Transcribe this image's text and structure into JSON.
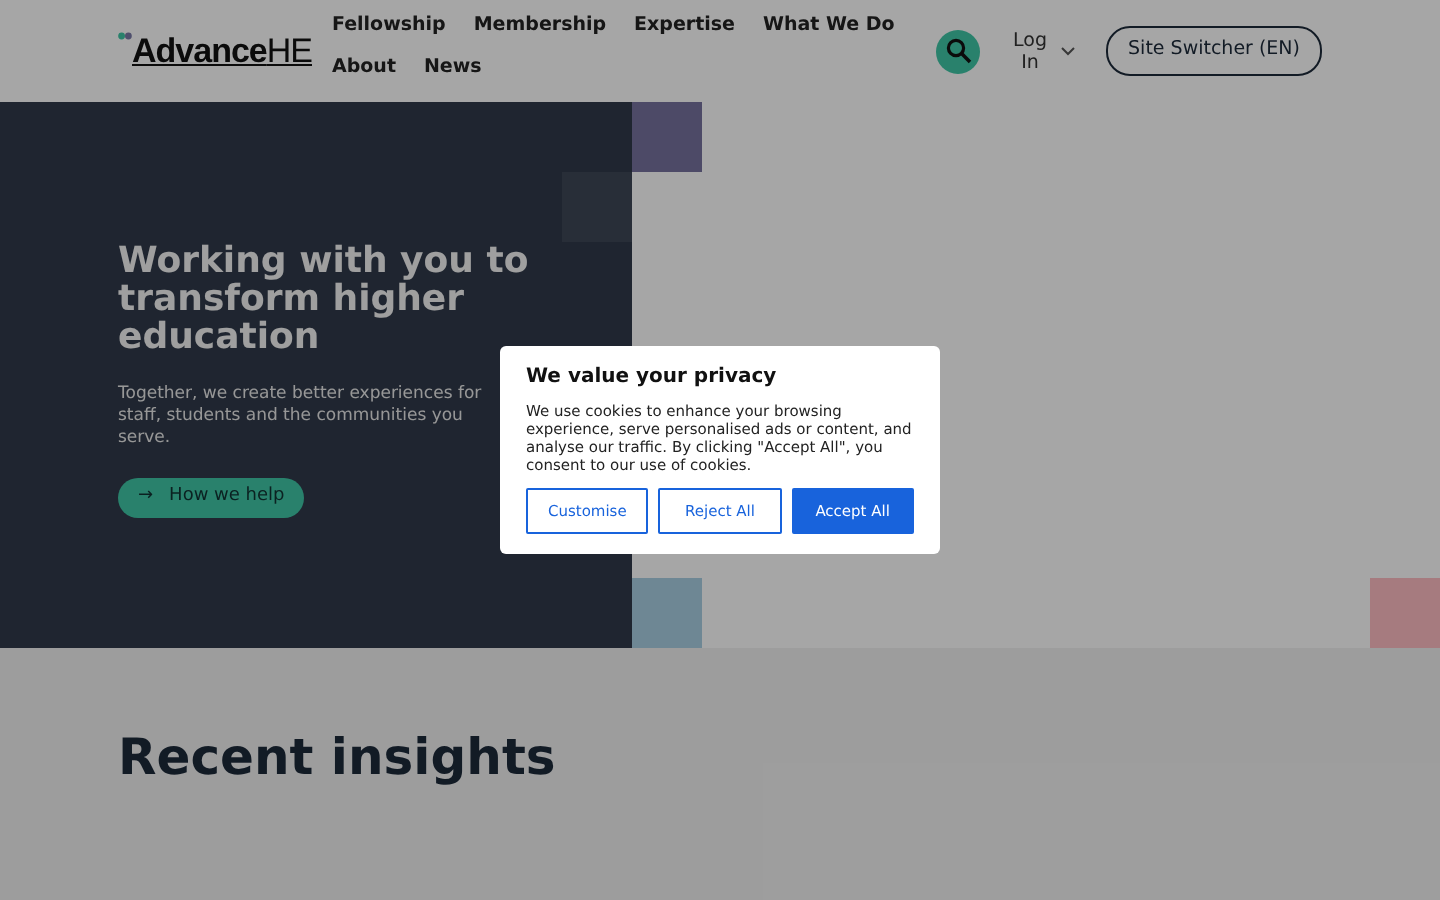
{
  "header": {
    "logo": {
      "prefix": "Advance",
      "suffix": "HE"
    },
    "nav": [
      "Fellowship",
      "Membership",
      "Expertise",
      "What We Do",
      "About",
      "News"
    ],
    "login": "Log In",
    "site_switcher": "Site Switcher (EN)"
  },
  "hero": {
    "title": "Working with you to transform higher education",
    "subtitle": "Together, we create better experiences for staff, students and the communities you serve.",
    "button": "How we help",
    "button_icon": "→"
  },
  "insights": {
    "title": "Recent insights"
  },
  "cookie_dialog": {
    "title": "We value your privacy",
    "text": "We use cookies to enhance your browsing experience, serve personalised ads or content, and analyse our traffic. By clicking \"Accept All\", you consent to our use of cookies.",
    "buttons": [
      {
        "label": "Customise",
        "kind": "outline"
      },
      {
        "label": "Reject All",
        "kind": "outline"
      },
      {
        "label": "Accept All",
        "kind": "primary"
      }
    ]
  }
}
